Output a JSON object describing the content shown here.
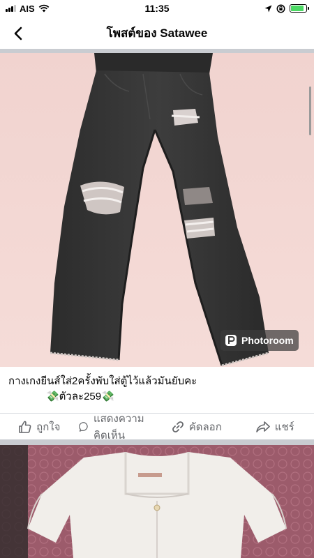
{
  "status_bar": {
    "carrier": "AIS",
    "time": "11:35",
    "battery_level": 0.85
  },
  "header": {
    "title": "โพสต์ของ Satawee",
    "back_icon": "chevron-left-icon"
  },
  "post": {
    "watermark": "Photoroom",
    "caption_line1": "กางเกงยีนส์ใส่2ครั้งพับใส่ตู้ไว้แล้วมันยับคะ",
    "caption_line2": "💸ตัวละ259💸"
  },
  "actions": {
    "like": "ถูกใจ",
    "comment": "แสดงความคิดเห็น",
    "copy": "คัดลอก",
    "share": "แชร์"
  },
  "colors": {
    "photo_background": "#f3d6d3",
    "jeans": "#3a3a3a",
    "action_text": "#65676b",
    "separator": "#c9ccd1",
    "battery": "#4cd964"
  }
}
